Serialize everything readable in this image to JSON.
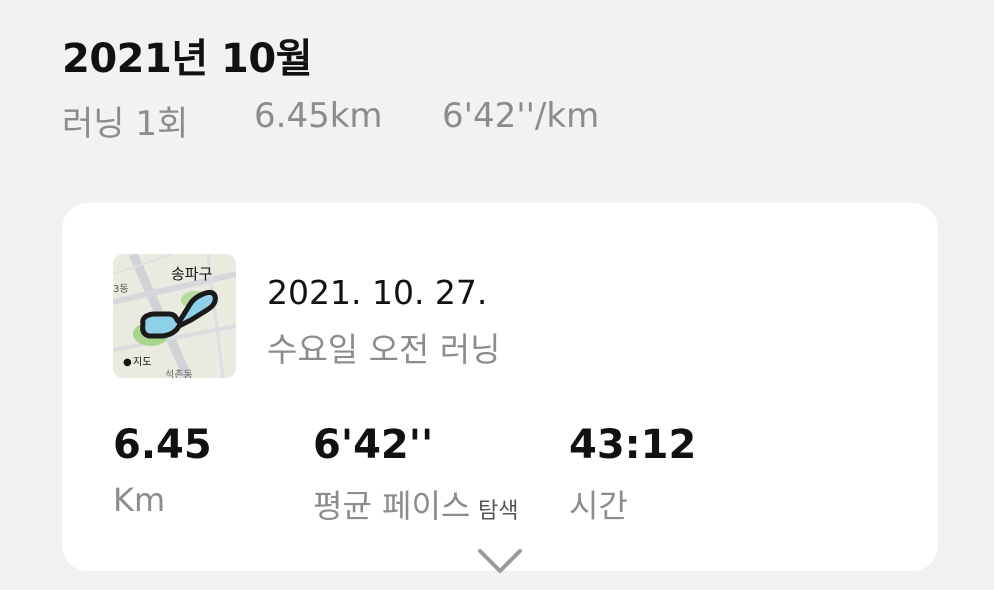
{
  "header": {
    "month_title": "2021년 10월",
    "summary": {
      "run_count": "러닝 1회",
      "distance": "6.45km",
      "pace": "6'42''/km"
    }
  },
  "run_card": {
    "map": {
      "district_label": "송파구",
      "neighborhood_top": "3동",
      "neighborhood_bottom": "석촌동",
      "attribution": "지도",
      "attribution_icon": "apple-logo-icon",
      "route_color": "#1a1a1a",
      "route_fill": "#8ed0e8",
      "park_color": "#a9d58f"
    },
    "date": "2021. 10. 27.",
    "subtitle": "수요일 오전 러닝",
    "stats": {
      "distance": {
        "value": "6.45",
        "label": "Km"
      },
      "pace": {
        "value": "6'42''",
        "label": "평균 페이스"
      },
      "time": {
        "value": "43:12",
        "label": "시간"
      }
    },
    "explore_label": "탐색",
    "expand_icon": "chevron-down-icon"
  }
}
